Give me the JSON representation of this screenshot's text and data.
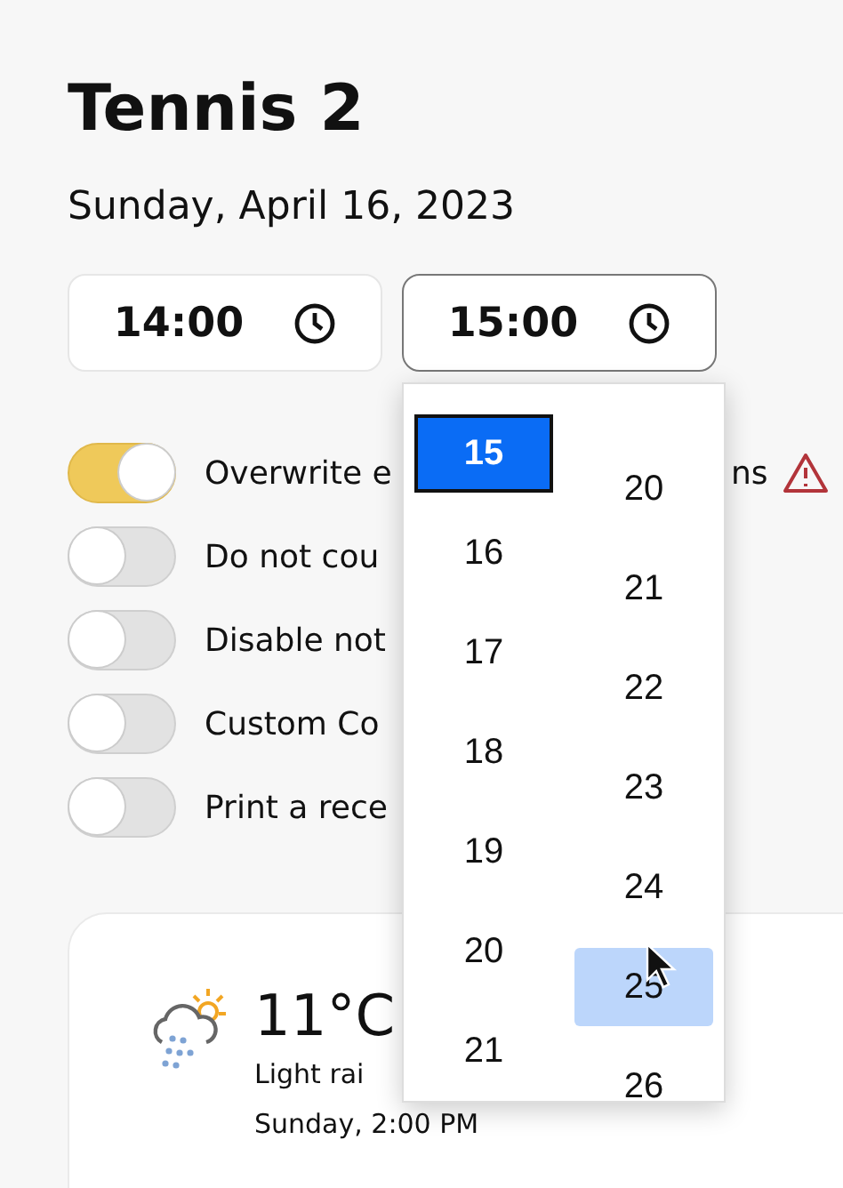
{
  "title": "Tennis 2",
  "date": "Sunday, April 16, 2023",
  "time_fields": [
    {
      "value": "14:00",
      "focused": false
    },
    {
      "value": "15:00",
      "focused": true
    }
  ],
  "toggles": [
    {
      "label": "Overwrite e",
      "label_end": "ns",
      "on": true,
      "warning": true
    },
    {
      "label": "Do not cou",
      "on": false,
      "warning": false
    },
    {
      "label": "Disable not",
      "on": false,
      "warning": false
    },
    {
      "label": "Custom Co",
      "on": false,
      "warning": false
    },
    {
      "label": "Print a rece",
      "on": false,
      "warning": false
    }
  ],
  "weather": {
    "temperature": "11°C",
    "condition": "Light rai",
    "time": "Sunday, 2:00 PM"
  },
  "time_picker": {
    "hours": [
      {
        "label": "15",
        "selected": true
      },
      {
        "label": "16",
        "selected": false
      },
      {
        "label": "17",
        "selected": false
      },
      {
        "label": "18",
        "selected": false
      },
      {
        "label": "19",
        "selected": false
      },
      {
        "label": "20",
        "selected": false
      },
      {
        "label": "21",
        "selected": false
      }
    ],
    "minutes": [
      {
        "label": "20",
        "hovered": false
      },
      {
        "label": "21",
        "hovered": false
      },
      {
        "label": "22",
        "hovered": false
      },
      {
        "label": "23",
        "hovered": false
      },
      {
        "label": "24",
        "hovered": false
      },
      {
        "label": "25",
        "hovered": true
      },
      {
        "label": "26",
        "hovered": false
      }
    ]
  }
}
